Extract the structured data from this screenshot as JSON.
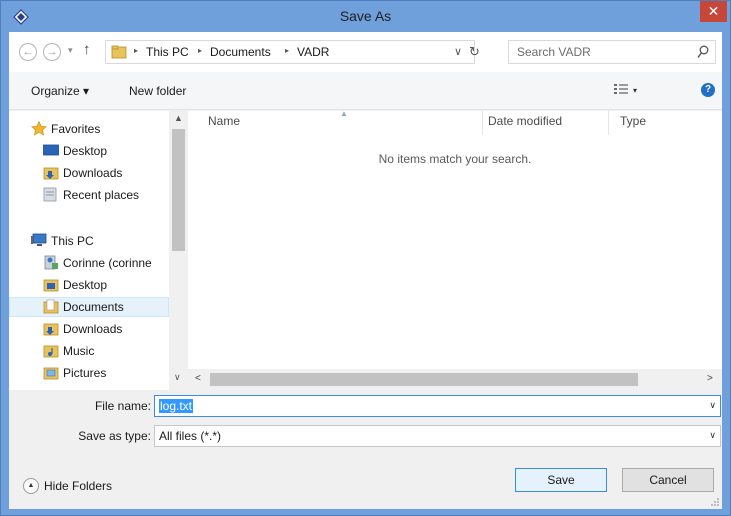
{
  "window": {
    "title": "Save As",
    "close_glyph": "✕",
    "accent": "#6fa0dc"
  },
  "address": {
    "back_glyph": "←",
    "forward_glyph": "→",
    "recent_glyph": "▾",
    "up_glyph": "↑",
    "crumbs": [
      "This PC",
      "Documents",
      "VADR"
    ],
    "separator": "▸",
    "dropdown_glyph": "∨",
    "refresh_glyph": "↻",
    "search_placeholder": "Search VADR"
  },
  "toolbar": {
    "organize": "Organize ▾",
    "new_folder": "New folder",
    "view_drop": "▾",
    "help_glyph": "?"
  },
  "navigation": {
    "items": [
      {
        "label": "Favorites",
        "icon": "star-icon"
      },
      {
        "label": "Desktop",
        "icon": "desktop-icon"
      },
      {
        "label": "Downloads",
        "icon": "downloads-icon"
      },
      {
        "label": "Recent places",
        "icon": "recent-places-icon"
      },
      {
        "label": "This PC",
        "icon": "computer-icon"
      },
      {
        "label": "Corinne (corinne",
        "icon": "user-icon"
      },
      {
        "label": "Desktop",
        "icon": "desktop-folder-icon"
      },
      {
        "label": "Documents",
        "icon": "documents-icon",
        "selected": true
      },
      {
        "label": "Downloads",
        "icon": "downloads-icon"
      },
      {
        "label": "Music",
        "icon": "music-icon"
      },
      {
        "label": "Pictures",
        "icon": "pictures-icon"
      }
    ],
    "scroll_up_glyph": "▲",
    "scroll_down_glyph": "∨"
  },
  "file_list": {
    "columns": [
      "Name",
      "Date modified",
      "Type"
    ],
    "sort_glyph": "▲",
    "empty_message": "No items match your search.",
    "scroll_left_glyph": "<",
    "scroll_right_glyph": ">"
  },
  "form": {
    "file_name_label": "File name:",
    "file_name_value": "log.txt",
    "save_type_label": "Save as type:",
    "save_type_value": "All files (*.*)",
    "dropdown_glyph": "∨"
  },
  "footer": {
    "hide_folders": "Hide Folders",
    "hide_glyph": "▲",
    "save": "Save",
    "cancel": "Cancel"
  }
}
